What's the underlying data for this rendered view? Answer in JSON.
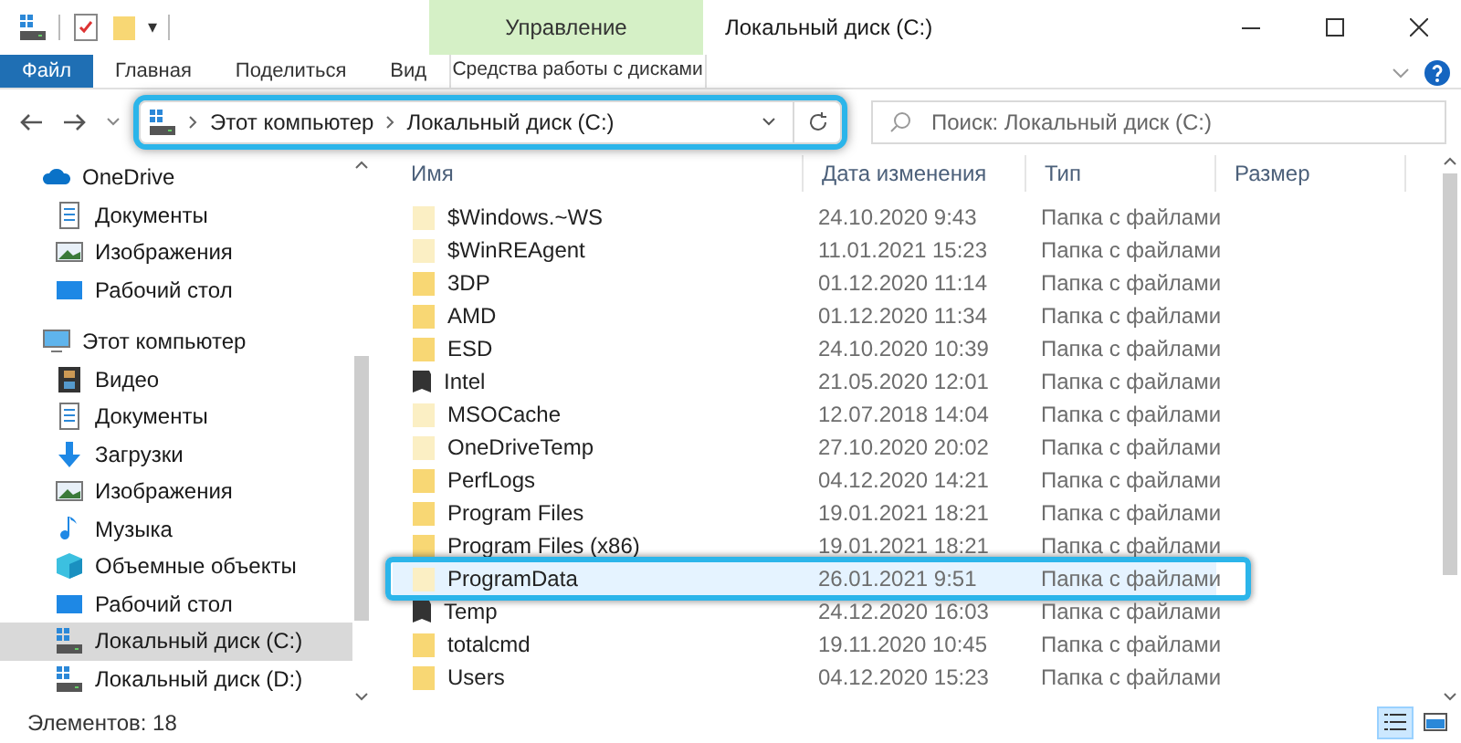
{
  "window": {
    "title": "Локальный диск (C:)"
  },
  "quick_access": [
    "▾"
  ],
  "context_tab": {
    "group": "Управление",
    "label": "Средства работы с дисками"
  },
  "ribbon_tabs": [
    {
      "label": "Файл",
      "selected": true
    },
    {
      "label": "Главная",
      "selected": false
    },
    {
      "label": "Поделиться",
      "selected": false
    },
    {
      "label": "Вид",
      "selected": false
    }
  ],
  "address_bar": {
    "highlighted": true,
    "path": [
      "Этот компьютер",
      "Локальный диск (C:)"
    ]
  },
  "search": {
    "placeholder": "Поиск: Локальный диск (C:)"
  },
  "sidebar": {
    "items": [
      {
        "label": "OneDrive",
        "kind": "cloud",
        "selected": false,
        "children": [
          {
            "label": "Документы",
            "kind": "document",
            "selected": false
          },
          {
            "label": "Изображения",
            "kind": "image",
            "selected": false
          },
          {
            "label": "Рабочий стол",
            "kind": "desktop",
            "selected": false
          }
        ]
      },
      {
        "label": "Этот компьютер",
        "kind": "computer",
        "selected": false,
        "children": [
          {
            "label": "Видео",
            "kind": "video",
            "selected": false
          },
          {
            "label": "Документы",
            "kind": "document",
            "selected": false
          },
          {
            "label": "Загрузки",
            "kind": "download",
            "selected": false
          },
          {
            "label": "Изображения",
            "kind": "image",
            "selected": false
          },
          {
            "label": "Музыка",
            "kind": "music",
            "selected": false
          },
          {
            "label": "Объемные объекты",
            "kind": "cube",
            "selected": false
          },
          {
            "label": "Рабочий стол",
            "kind": "desktop",
            "selected": false
          },
          {
            "label": "Локальный диск (C:)",
            "kind": "drive",
            "selected": true
          },
          {
            "label": "Локальный диск (D:)",
            "kind": "drive",
            "selected": false
          }
        ]
      }
    ]
  },
  "table": {
    "columns": [
      "Имя",
      "Дата изменения",
      "Тип",
      "Размер"
    ],
    "rows": [
      {
        "name": "$Windows.~WS",
        "date": "24.10.2020 9:43",
        "type": "Папка с файлами",
        "kind": "folder",
        "hidden": true,
        "selected": false,
        "highlighted": false
      },
      {
        "name": "$WinREAgent",
        "date": "11.01.2021 15:23",
        "type": "Папка с файлами",
        "kind": "folder",
        "hidden": true,
        "selected": false,
        "highlighted": false
      },
      {
        "name": "3DP",
        "date": "01.12.2020 11:14",
        "type": "Папка с файлами",
        "kind": "folder",
        "hidden": false,
        "selected": false,
        "highlighted": false
      },
      {
        "name": "AMD",
        "date": "01.12.2020 11:34",
        "type": "Папка с файлами",
        "kind": "folder",
        "hidden": false,
        "selected": false,
        "highlighted": false
      },
      {
        "name": "ESD",
        "date": "24.10.2020 10:39",
        "type": "Папка с файлами",
        "kind": "folder",
        "hidden": false,
        "selected": false,
        "highlighted": false
      },
      {
        "name": "Intel",
        "date": "21.05.2020 12:01",
        "type": "Папка с файлами",
        "kind": "link",
        "hidden": false,
        "selected": false,
        "highlighted": false
      },
      {
        "name": "MSOCache",
        "date": "12.07.2018 14:04",
        "type": "Папка с файлами",
        "kind": "folder",
        "hidden": true,
        "selected": false,
        "highlighted": false
      },
      {
        "name": "OneDriveTemp",
        "date": "27.10.2020 20:02",
        "type": "Папка с файлами",
        "kind": "folder",
        "hidden": true,
        "selected": false,
        "highlighted": false
      },
      {
        "name": "PerfLogs",
        "date": "04.12.2020 14:21",
        "type": "Папка с файлами",
        "kind": "folder",
        "hidden": false,
        "selected": false,
        "highlighted": false
      },
      {
        "name": "Program Files",
        "date": "19.01.2021 18:21",
        "type": "Папка с файлами",
        "kind": "folder",
        "hidden": false,
        "selected": false,
        "highlighted": false
      },
      {
        "name": "Program Files (x86)",
        "date": "19.01.2021 18:21",
        "type": "Папка с файлами",
        "kind": "folder",
        "hidden": false,
        "selected": false,
        "highlighted": false
      },
      {
        "name": "ProgramData",
        "date": "26.01.2021 9:51",
        "type": "Папка с файлами",
        "kind": "folder",
        "hidden": true,
        "selected": true,
        "highlighted": true
      },
      {
        "name": "Temp",
        "date": "24.12.2020 16:03",
        "type": "Папка с файлами",
        "kind": "link",
        "hidden": false,
        "selected": false,
        "highlighted": false
      },
      {
        "name": "totalcmd",
        "date": "19.11.2020 10:45",
        "type": "Папка с файлами",
        "kind": "folder",
        "hidden": false,
        "selected": false,
        "highlighted": false
      },
      {
        "name": "Users",
        "date": "04.12.2020 15:23",
        "type": "Папка с файлами",
        "kind": "folder",
        "hidden": false,
        "selected": false,
        "highlighted": false
      }
    ]
  },
  "status_bar": {
    "count": "Элементов: 18"
  },
  "view_buttons": [
    {
      "kind": "details",
      "selected": true
    },
    {
      "kind": "tiles",
      "selected": false
    }
  ]
}
